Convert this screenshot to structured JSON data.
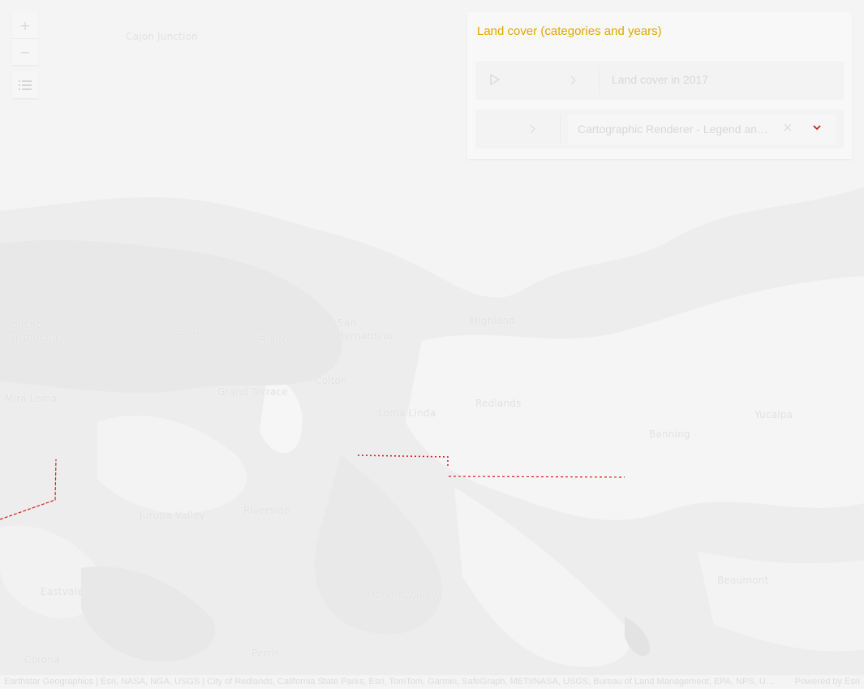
{
  "map": {
    "places": [
      {
        "name": "Cajon Junction"
      },
      {
        "name": "Rancho Cucamonga"
      },
      {
        "name": "Fontana"
      },
      {
        "name": "Rialto"
      },
      {
        "name": "San Bernardino"
      },
      {
        "name": "Highland"
      },
      {
        "name": "Colton"
      },
      {
        "name": "Grand Terrace"
      },
      {
        "name": "Redlands"
      },
      {
        "name": "Loma Linda"
      },
      {
        "name": "Yucaipa"
      },
      {
        "name": "Mira Loma"
      },
      {
        "name": "Riverside"
      },
      {
        "name": "Moreno Valley"
      },
      {
        "name": "Beaumont"
      },
      {
        "name": "Banning"
      },
      {
        "name": "Perris"
      },
      {
        "name": "Corona"
      },
      {
        "name": "Eastvale"
      },
      {
        "name": "Jurupa Valley"
      }
    ]
  },
  "controls": {
    "zoom_in": "+",
    "zoom_out": "−",
    "layer_list_icon": "list-icon"
  },
  "panel": {
    "title": "Land cover (categories and years)",
    "time_row": {
      "play_icon": "play-icon",
      "next_icon": "chevron-right-icon",
      "label": "Land cover in 2017"
    },
    "renderer_row": {
      "next_icon": "chevron-right-icon",
      "selected": "Cartographic Renderer - Legend and attributes",
      "clear_icon": "close-icon",
      "dropdown_icon": "chevron-down-icon"
    }
  },
  "attribution": {
    "text": "Earthstar Geographics | Esri, NASA, NGA, USGS | City of Redlands, California State Parks, Esri, TomTom, Garmin, SafeGraph, METI/NASA, USGS, Bureau of Land Management, EPA, NPS, US Census Bureau, USDA, USFWS",
    "powered_by": "Powered by Esri"
  },
  "colors": {
    "title": "#e6a400",
    "accent": "#cc1111",
    "map_background": "#ececec"
  }
}
